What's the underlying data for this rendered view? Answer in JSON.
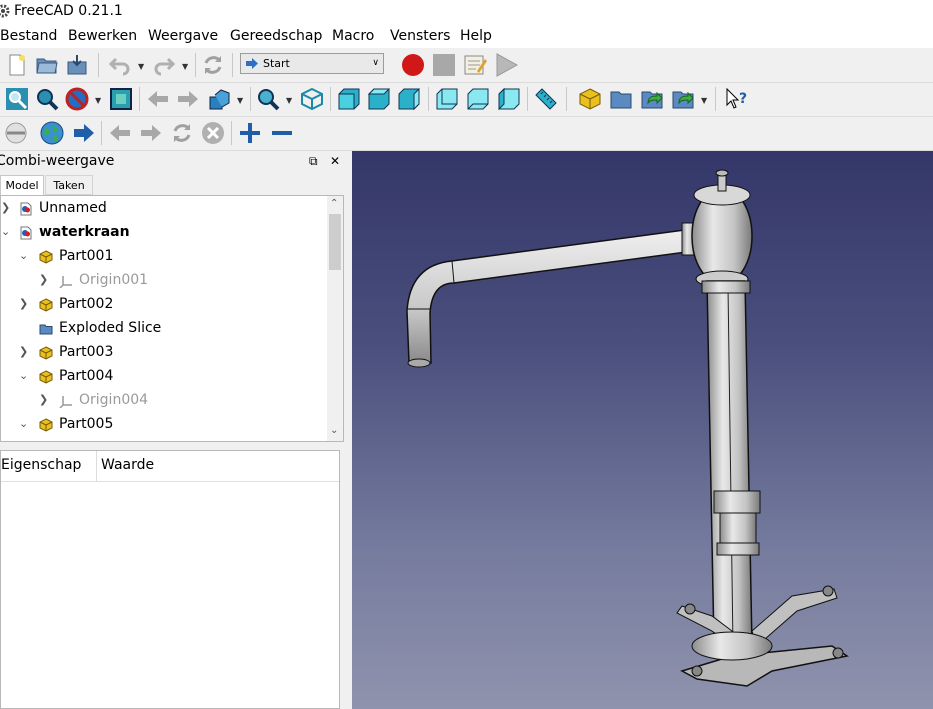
{
  "app": {
    "title": "FreeCAD 0.21.1"
  },
  "menu": [
    "Bestand",
    "Bewerken",
    "Weergave",
    "Gereedschap",
    "Macro",
    "Vensters",
    "Help"
  ],
  "toolbar": {
    "workbench": "Start"
  },
  "panel": {
    "title": "Combi-weergave",
    "tabs": [
      "Model",
      "Taken"
    ],
    "tree": [
      {
        "label": "Unnamed",
        "icon": "document-icon",
        "state": "collapsed"
      },
      {
        "label": "waterkraan",
        "icon": "document-icon",
        "state": "expanded",
        "bold": true
      },
      {
        "label": "Part001",
        "icon": "part-icon",
        "state": "expanded"
      },
      {
        "label": "Origin001",
        "icon": "origin-icon",
        "state": "collapsed",
        "greyed": true
      },
      {
        "label": "Part002",
        "icon": "part-icon",
        "state": "collapsed"
      },
      {
        "label": "Exploded Slice",
        "icon": "folder-icon",
        "state": "none"
      },
      {
        "label": "Part003",
        "icon": "part-icon",
        "state": "collapsed"
      },
      {
        "label": "Part004",
        "icon": "part-icon",
        "state": "expanded"
      },
      {
        "label": "Origin004",
        "icon": "origin-icon",
        "state": "collapsed",
        "greyed": true
      },
      {
        "label": "Part005",
        "icon": "part-icon",
        "state": "expanded"
      }
    ],
    "properties": {
      "col1": "Eigenschap",
      "col2": "Waarde"
    }
  },
  "colors": {
    "viewport_top": "#343769",
    "viewport_bottom": "#8f93ad",
    "record": "#d01818",
    "accent_blue": "#1f6fc4",
    "part_yellow": "#e8c020"
  }
}
